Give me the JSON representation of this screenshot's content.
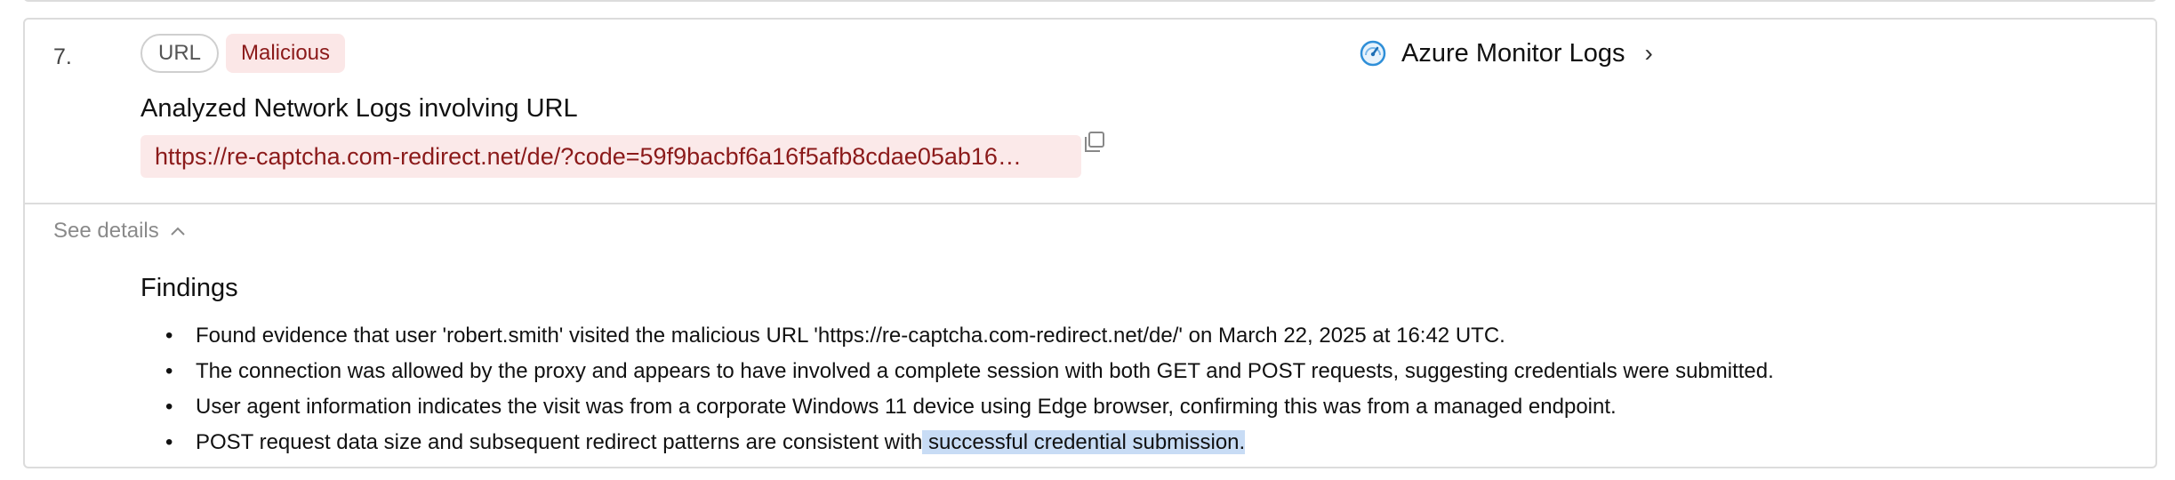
{
  "item": {
    "index": "7.",
    "type_chip": "URL",
    "verdict_chip": "Malicious",
    "source": {
      "label": "Azure Monitor Logs",
      "icon": "gauge-icon"
    },
    "subtitle": "Analyzed Network Logs involving URL",
    "url": "https://re-captcha.com-redirect.net/de/?code=59f9bacbf6a16f5afb8cdae05ab16…",
    "see_details_label": "See details",
    "findings": {
      "title": "Findings",
      "items": [
        "Found evidence that user 'robert.smith' visited the malicious URL 'https://re-captcha.com-redirect.net/de/' on March 22, 2025 at 16:42 UTC.",
        "The connection was allowed by the proxy and appears to have involved a complete session with both GET and POST requests, suggesting credentials were submitted.",
        "User agent information indicates the visit was from a corporate Windows 11 device using Edge browser, confirming this was from a managed endpoint."
      ],
      "last_item_prefix": "POST request data size and subsequent redirect patterns are consistent with",
      "last_item_highlighted": " successful credential submission."
    }
  },
  "colors": {
    "malicious_bg": "#fbe7e7",
    "malicious_text": "#8b1a1a",
    "highlight": "#c8dcf5",
    "border": "#dcdcdc"
  }
}
